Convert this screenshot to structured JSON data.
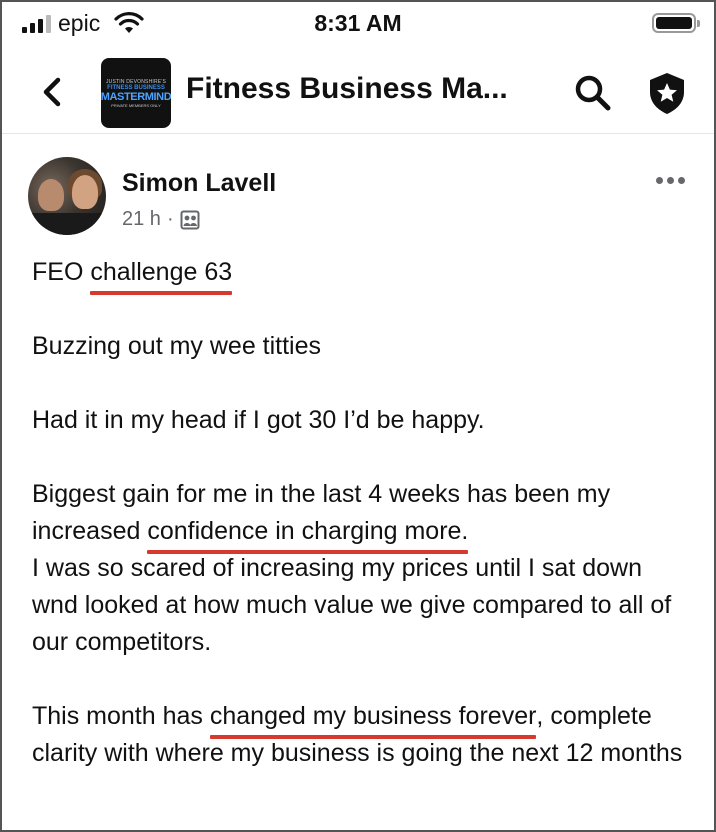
{
  "status_bar": {
    "carrier": "epic",
    "time": "8:31 AM"
  },
  "header": {
    "logo_lines": [
      "JUSTIN DEVONSHIRE'S",
      "FITNESS BUSINESS",
      "MASTERMIND",
      "PRIVATE MEMBERS ONLY"
    ],
    "title": "Fitness Business Ma..."
  },
  "post": {
    "author": "Simon Lavell",
    "time_ago": "21 h",
    "separator": "·",
    "paragraphs": [
      {
        "before": "FEO ",
        "underlined": "challenge 63",
        "after": ""
      },
      {
        "text": "Buzzing out my wee titties"
      },
      {
        "text": "Had it in my head if I got 30 I’d be happy."
      },
      {
        "before": "Biggest gain for me in the last 4 weeks has been my increased ",
        "underlined": "confidence in charging more.",
        "after": "I was so scared of increasing my prices until I sat down wnd looked at how much value we give compared to all of our competitors."
      },
      {
        "before": "This month has ",
        "underlined": "changed my business forever",
        "after": ", complete clarity with where my business is going the next 12 months"
      }
    ]
  },
  "colors": {
    "underline": "#d63a2f",
    "meta_text": "#65676b"
  }
}
